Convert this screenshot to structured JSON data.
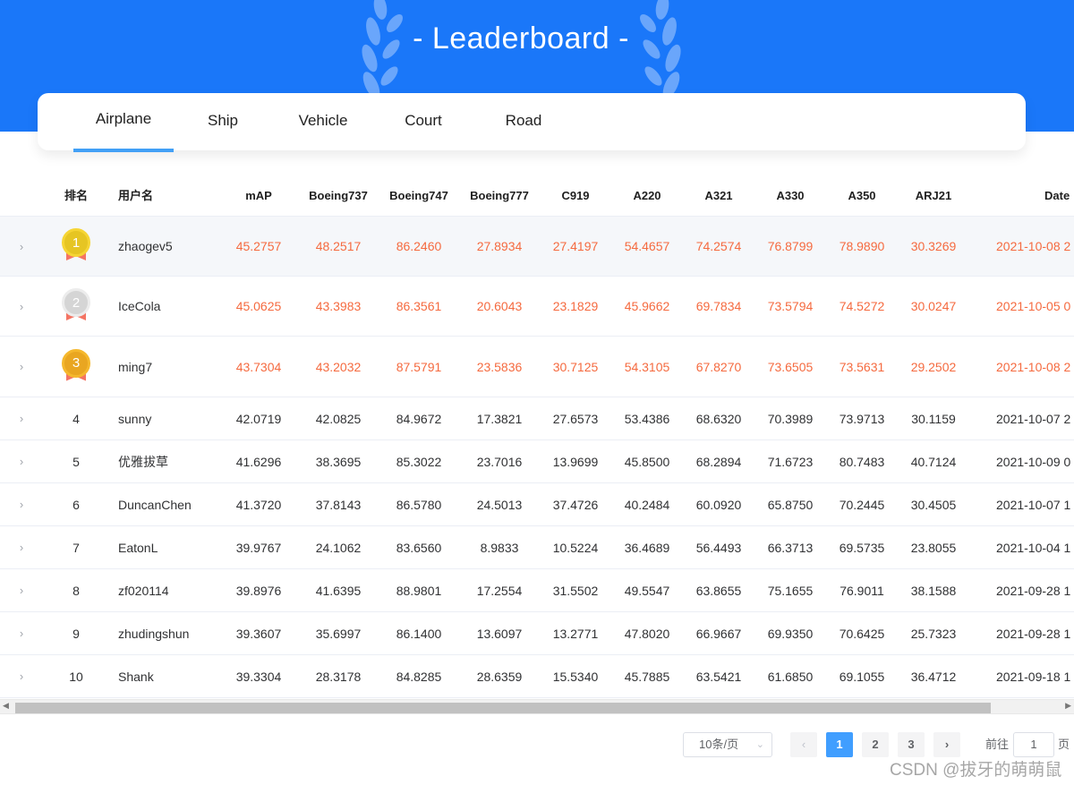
{
  "header": {
    "title": "- Leaderboard -"
  },
  "tabs": [
    {
      "label": "Airplane",
      "active": true
    },
    {
      "label": "Ship",
      "active": false
    },
    {
      "label": "Vehicle",
      "active": false
    },
    {
      "label": "Court",
      "active": false
    },
    {
      "label": "Road",
      "active": false
    }
  ],
  "table": {
    "columns": [
      "排名",
      "用户名",
      "mAP",
      "Boeing737",
      "Boeing747",
      "Boeing777",
      "C919",
      "A220",
      "A321",
      "A330",
      "A350",
      "ARJ21",
      "Date"
    ],
    "rows": [
      {
        "rank": "1",
        "medal": "gold",
        "user": "zhaogev5",
        "values": [
          "45.2757",
          "48.2517",
          "86.2460",
          "27.8934",
          "27.4197",
          "54.4657",
          "74.2574",
          "76.8799",
          "78.9890",
          "30.3269"
        ],
        "date": "2021-10-08 2"
      },
      {
        "rank": "2",
        "medal": "silver",
        "user": "IceCola",
        "values": [
          "45.0625",
          "43.3983",
          "86.3561",
          "20.6043",
          "23.1829",
          "45.9662",
          "69.7834",
          "73.5794",
          "74.5272",
          "30.0247"
        ],
        "date": "2021-10-05 0"
      },
      {
        "rank": "3",
        "medal": "bronze",
        "user": "ming7",
        "values": [
          "43.7304",
          "43.2032",
          "87.5791",
          "23.5836",
          "30.7125",
          "54.3105",
          "67.8270",
          "73.6505",
          "73.5631",
          "29.2502"
        ],
        "date": "2021-10-08 2"
      },
      {
        "rank": "4",
        "medal": null,
        "user": "sunny",
        "values": [
          "42.0719",
          "42.0825",
          "84.9672",
          "17.3821",
          "27.6573",
          "53.4386",
          "68.6320",
          "70.3989",
          "73.9713",
          "30.1159"
        ],
        "date": "2021-10-07 2"
      },
      {
        "rank": "5",
        "medal": null,
        "user": "优雅拔草",
        "values": [
          "41.6296",
          "38.3695",
          "85.3022",
          "23.7016",
          "13.9699",
          "45.8500",
          "68.2894",
          "71.6723",
          "80.7483",
          "40.7124"
        ],
        "date": "2021-10-09 0"
      },
      {
        "rank": "6",
        "medal": null,
        "user": "DuncanChen",
        "values": [
          "41.3720",
          "37.8143",
          "86.5780",
          "24.5013",
          "37.4726",
          "40.2484",
          "60.0920",
          "65.8750",
          "70.2445",
          "30.4505"
        ],
        "date": "2021-10-07 1"
      },
      {
        "rank": "7",
        "medal": null,
        "user": "EatonL",
        "values": [
          "39.9767",
          "24.1062",
          "83.6560",
          "8.9833",
          "10.5224",
          "36.4689",
          "56.4493",
          "66.3713",
          "69.5735",
          "23.8055"
        ],
        "date": "2021-10-04 1"
      },
      {
        "rank": "8",
        "medal": null,
        "user": "zf020114",
        "values": [
          "39.8976",
          "41.6395",
          "88.9801",
          "17.2554",
          "31.5502",
          "49.5547",
          "63.8655",
          "75.1655",
          "76.9011",
          "38.1588"
        ],
        "date": "2021-09-28 1"
      },
      {
        "rank": "9",
        "medal": null,
        "user": "zhudingshun",
        "values": [
          "39.3607",
          "35.6997",
          "86.1400",
          "13.6097",
          "13.2771",
          "47.8020",
          "66.9667",
          "69.9350",
          "70.6425",
          "25.7323"
        ],
        "date": "2021-09-28 1"
      },
      {
        "rank": "10",
        "medal": null,
        "user": "Shank",
        "values": [
          "39.3304",
          "28.3178",
          "84.8285",
          "28.6359",
          "15.5340",
          "45.7885",
          "63.5421",
          "61.6850",
          "69.1055",
          "36.4712"
        ],
        "date": "2021-09-18 1"
      }
    ]
  },
  "icons": {
    "expand": "›",
    "prev": "‹",
    "next": "›",
    "select_chevron": "⌄",
    "scroll_left": "◀",
    "scroll_right": "▶"
  },
  "pagination": {
    "page_size": "10条/页",
    "pages": [
      "1",
      "2",
      "3"
    ],
    "current_page": "1",
    "goto_prefix": "前往",
    "goto_value": "1",
    "goto_suffix": "页"
  },
  "watermark": "CSDN @拔牙的萌萌鼠",
  "colors": {
    "header_blue": "#1a77f9",
    "tab_underline": "#42a0f6",
    "top3_text": "#f56a3f",
    "page_active": "#409eff"
  }
}
